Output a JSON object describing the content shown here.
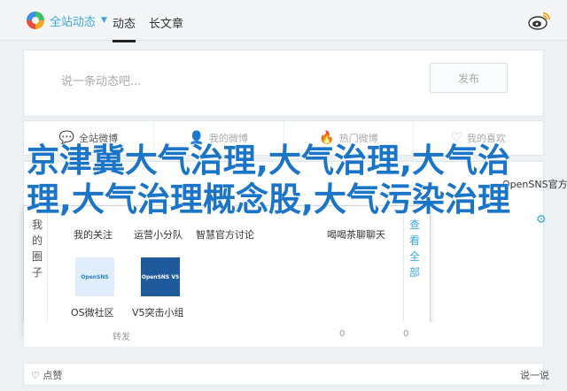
{
  "nav": {
    "site_name": "全站动态",
    "tab_active": "动态",
    "tab_second": "长文章"
  },
  "composer": {
    "placeholder": "说一条动态吧...",
    "publish": "发布"
  },
  "filters": [
    "全站微博",
    "我的微博",
    "热门微博",
    "我的喜欢"
  ],
  "feed": {
    "card_title": "OpenSNS官方",
    "dropdown": {
      "left_label": "我的圈子",
      "right_label": "查看全部",
      "groups": [
        "我的关注",
        "运营小分队",
        "智慧官方讨论",
        "喝喝茶聊聊天",
        "OS微社区",
        "V5突击小组"
      ],
      "os_thumb": "OpenSNS",
      "v5_thumb": "OpenSNS V5"
    }
  },
  "actions": [
    "转发",
    "0",
    "0"
  ],
  "bottom": {
    "fav": "点赞",
    "say": "说一说"
  },
  "headline": "京津冀大气治理,大气治理,大气治理,大气治理概念股,大气污染治理",
  "colors": {
    "accent": "#3aa8df",
    "headline": "#1a74c8"
  }
}
